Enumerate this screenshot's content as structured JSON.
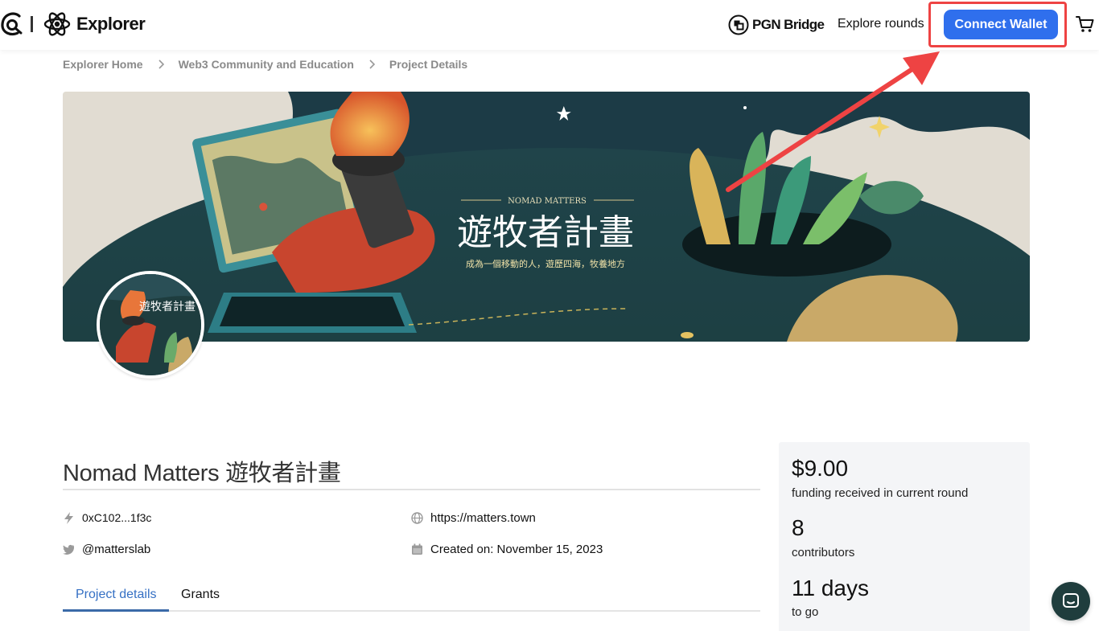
{
  "header": {
    "brand": "Explorer",
    "pgn_label": "PGN Bridge",
    "explore_rounds": "Explore rounds",
    "connect_wallet": "Connect Wallet"
  },
  "breadcrumb": [
    "Explorer Home",
    "Web3 Community and Education",
    "Project Details"
  ],
  "banner": {
    "eyebrow": "NOMAD MATTERS",
    "title_cn": "遊牧者計畫",
    "subtitle_cn": "成為一個移動的人，遊歷四海，牧養地方"
  },
  "avatar": {
    "title_cn": "遊牧者計畫"
  },
  "project": {
    "title": "Nomad Matters 遊牧者計畫",
    "address": "0xC102...1f3c",
    "website": "https://matters.town",
    "twitter": "@matterslab",
    "created": "Created on: November 15, 2023"
  },
  "tabs": [
    "Project details",
    "Grants"
  ],
  "stats": {
    "funding_amount": "$9.00",
    "funding_label": "funding received in current round",
    "contributors_count": "8",
    "contributors_label": "contributors",
    "days": "11 days",
    "days_label": "to go"
  },
  "colors": {
    "accent": "#2f6fed",
    "highlight": "#ee4343",
    "tab_active": "#3570c4"
  },
  "icons": [
    "gitcoin-logo-icon",
    "atom-logo-icon",
    "pgn-logo-icon",
    "cart-icon",
    "bolt-icon",
    "globe-icon",
    "twitter-icon",
    "calendar-icon",
    "chevron-right-icon",
    "chat-icon"
  ]
}
